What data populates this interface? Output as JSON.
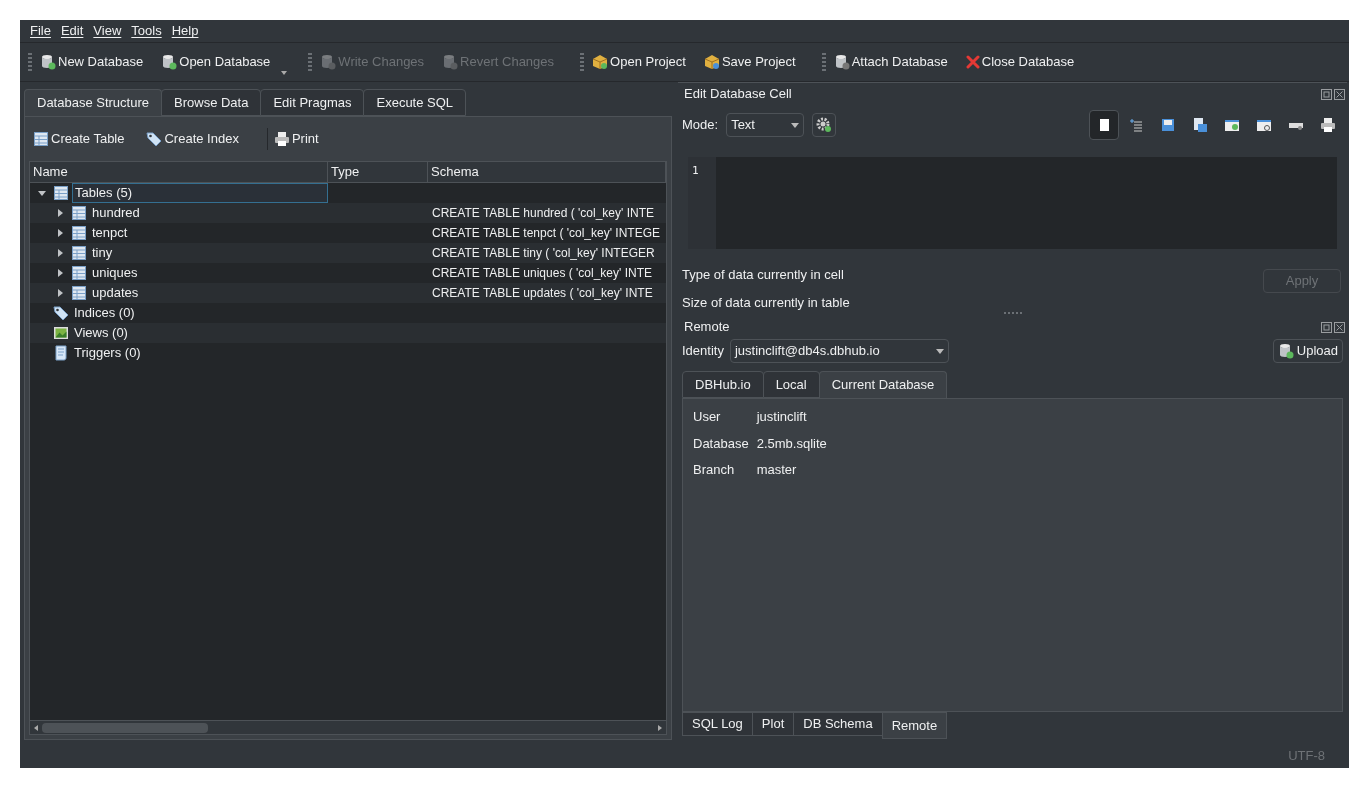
{
  "menu": [
    "File",
    "Edit",
    "View",
    "Tools",
    "Help"
  ],
  "toolbar": [
    [
      {
        "label": "New Database",
        "disabled": false,
        "has_menu": false
      },
      {
        "label": "Open Database",
        "disabled": false,
        "has_menu": true
      }
    ],
    [
      {
        "label": "Write Changes",
        "disabled": true,
        "has_menu": false
      },
      {
        "label": "Revert Changes",
        "disabled": true,
        "has_menu": false
      }
    ],
    [
      {
        "label": "Open Project",
        "disabled": false,
        "has_menu": false
      },
      {
        "label": "Save Project",
        "disabled": false,
        "has_menu": false
      }
    ],
    [
      {
        "label": "Attach Database",
        "disabled": false,
        "has_menu": false
      },
      {
        "label": "Close Database",
        "disabled": false,
        "has_menu": false
      }
    ]
  ],
  "main_tabs": [
    {
      "label": "Database Structure",
      "selected": true
    },
    {
      "label": "Browse Data",
      "selected": false
    },
    {
      "label": "Edit Pragmas",
      "selected": false
    },
    {
      "label": "Execute SQL",
      "selected": false
    }
  ],
  "structure_toolbar": [
    "Create Table",
    "Create Index",
    "Print"
  ],
  "tree": {
    "columns": [
      "Name",
      "Type",
      "Schema"
    ],
    "items": [
      {
        "name": "Tables (5)",
        "kind": "tables",
        "expanded": true,
        "focused": true,
        "children": [
          {
            "name": "hundred",
            "kind": "table",
            "expanded": false,
            "schema": "CREATE TABLE hundred ( 'col_key' INTE"
          },
          {
            "name": "tenpct",
            "kind": "table",
            "expanded": false,
            "schema": "CREATE TABLE tenpct ( 'col_key' INTEGE"
          },
          {
            "name": "tiny",
            "kind": "table",
            "expanded": false,
            "schema": "CREATE TABLE tiny ( 'col_key' INTEGER"
          },
          {
            "name": "uniques",
            "kind": "table",
            "expanded": false,
            "schema": "CREATE TABLE uniques ( 'col_key' INTE"
          },
          {
            "name": "updates",
            "kind": "table",
            "expanded": false,
            "schema": "CREATE TABLE updates ( 'col_key' INTE"
          }
        ]
      },
      {
        "name": "Indices (0)",
        "kind": "indices",
        "focused": false
      },
      {
        "name": "Views (0)",
        "kind": "views",
        "focused": false
      },
      {
        "name": "Triggers (0)",
        "kind": "triggers",
        "focused": false
      }
    ]
  },
  "edit_cell": {
    "title": "Edit Database Cell",
    "mode_label": "Mode:",
    "mode": "Text",
    "line_number": "1",
    "type_label": "Type of data currently in cell",
    "size_label": "Size of data currently in table",
    "apply": {
      "label": "Apply",
      "disabled": true
    }
  },
  "remote": {
    "title": "Remote",
    "identity_label": "Identity",
    "identity": "justinclift@db4s.dbhub.io",
    "upload": "Upload",
    "tabs": [
      {
        "label": "DBHub.io",
        "selected": false
      },
      {
        "label": "Local",
        "selected": false
      },
      {
        "label": "Current Database",
        "selected": true
      }
    ],
    "fields": [
      {
        "label": "User",
        "value": "justinclift"
      },
      {
        "label": "Database",
        "value": "2.5mb.sqlite"
      },
      {
        "label": "Branch",
        "value": "master"
      }
    ]
  },
  "dock_tabs": [
    {
      "label": "SQL Log",
      "selected": false
    },
    {
      "label": "Plot",
      "selected": false
    },
    {
      "label": "DB Schema",
      "selected": false
    },
    {
      "label": "Remote",
      "selected": true
    }
  ],
  "status_bar": {
    "encoding": "UTF-8"
  }
}
